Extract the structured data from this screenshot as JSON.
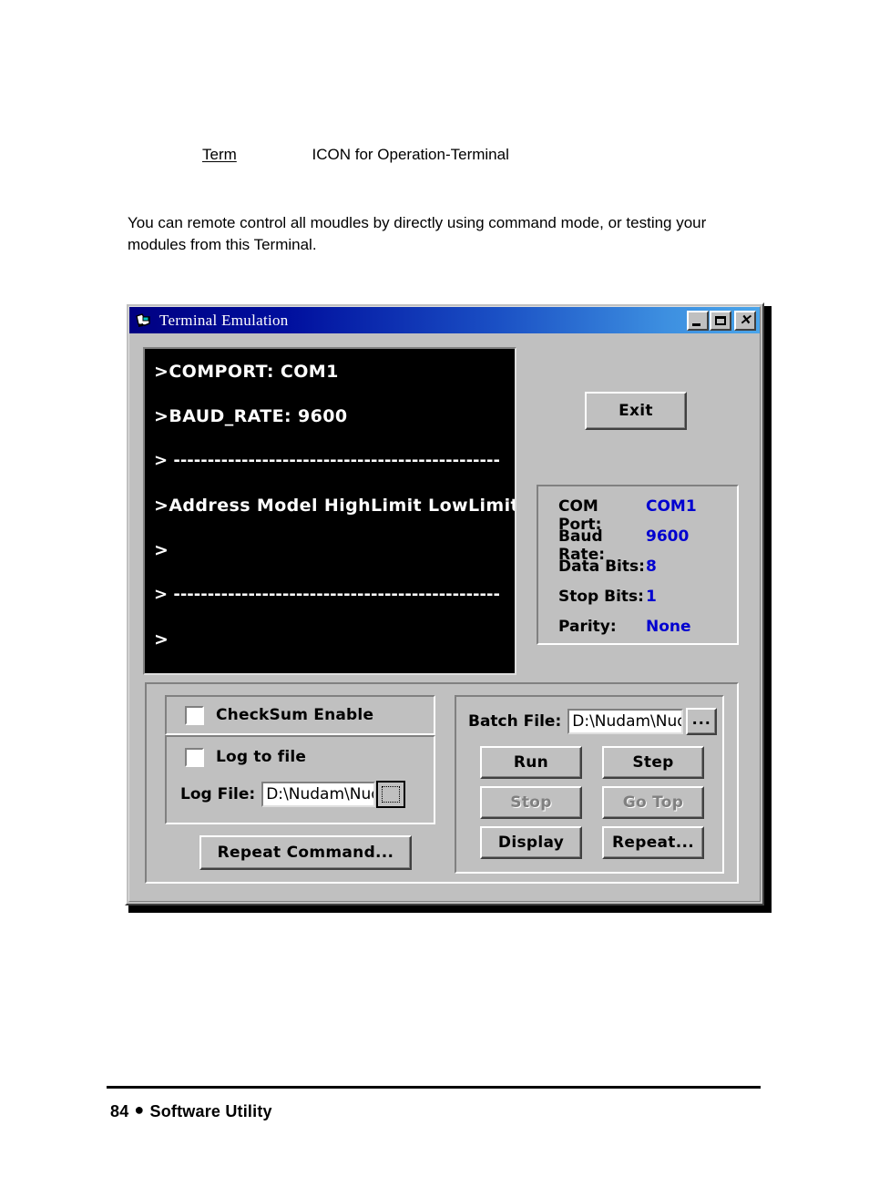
{
  "document": {
    "term_label": "Term",
    "term_description": "ICON for Operation-Terminal",
    "paragraph": "You can remote control all moudles by directly using command mode, or testing your modules from this Terminal.",
    "footer_page": "84",
    "footer_bullet": "●",
    "footer_section": "Software Utility"
  },
  "dialog": {
    "title": "Terminal Emulation",
    "titlebar_buttons": {
      "minimize": "_",
      "maximize": "□",
      "close": "×"
    },
    "console_lines": [
      ">COMPORT: COM1",
      ">BAUD_RATE: 9600",
      "> ------------------------------------------------",
      ">Address    Model HighLimit  LowLimit   F",
      ">",
      "> ------------------------------------------------",
      ">"
    ],
    "exit_button": "Exit",
    "comm_settings": {
      "rows": [
        {
          "key": "COM Port:",
          "value": "COM1"
        },
        {
          "key": "Baud Rate:",
          "value": "9600"
        },
        {
          "key": "Data Bits:",
          "value": "8"
        },
        {
          "key": "Stop Bits:",
          "value": "1"
        },
        {
          "key": "Parity:",
          "value": "None"
        }
      ],
      "value_color": "#0000d0"
    },
    "checksum": {
      "label": "CheckSum Enable",
      "checked": false
    },
    "log": {
      "checkbox_label": "Log to file",
      "checked": false,
      "file_label": "Log File:",
      "file_value": "D:\\Nudam\\Nud",
      "browse_label": ""
    },
    "repeat_command_button": "Repeat Command...",
    "batch": {
      "file_label": "Batch File:",
      "file_value": "D:\\Nudam\\Nud",
      "browse_label": "...",
      "buttons": [
        {
          "label": "Run",
          "disabled": false
        },
        {
          "label": "Step",
          "disabled": false
        },
        {
          "label": "Stop",
          "disabled": true
        },
        {
          "label": "Go Top",
          "disabled": true
        },
        {
          "label": "Display",
          "disabled": false
        },
        {
          "label": "Repeat...",
          "disabled": false
        }
      ]
    }
  }
}
